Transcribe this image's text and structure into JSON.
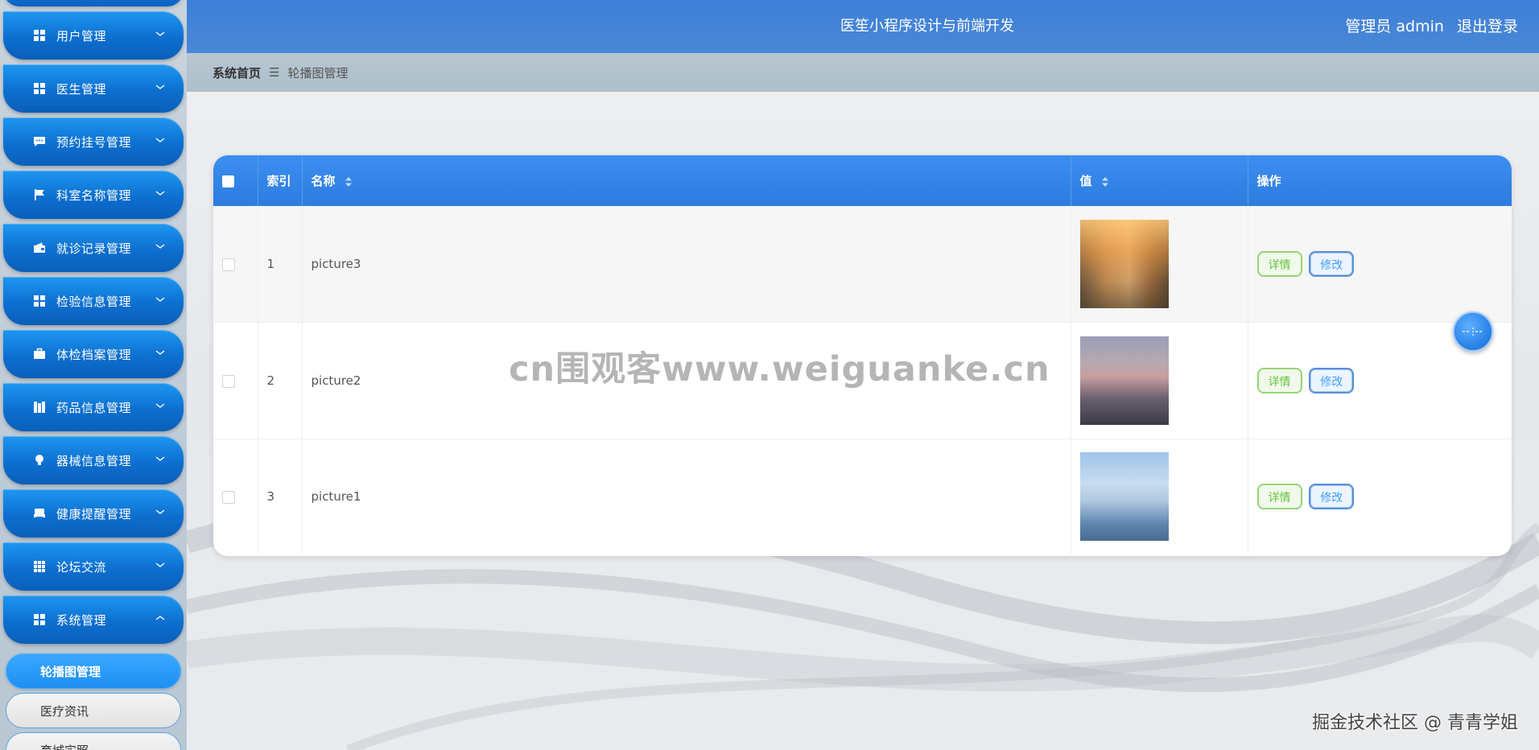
{
  "app": {
    "title": "医笙小程序设计与前端开发",
    "user_label": "管理员 admin",
    "logout_label": "退出登录"
  },
  "sidebar": {
    "items": [
      {
        "label": "用户管理",
        "icon": "grid-icon",
        "expanded": false
      },
      {
        "label": "医生管理",
        "icon": "grid-icon",
        "expanded": false
      },
      {
        "label": "预约挂号管理",
        "icon": "chat-icon",
        "expanded": false
      },
      {
        "label": "科室名称管理",
        "icon": "flag-icon",
        "expanded": false
      },
      {
        "label": "就诊记录管理",
        "icon": "wallet-icon",
        "expanded": false
      },
      {
        "label": "检验信息管理",
        "icon": "grid-icon",
        "expanded": false
      },
      {
        "label": "体检档案管理",
        "icon": "briefcase-icon",
        "expanded": false
      },
      {
        "label": "药品信息管理",
        "icon": "book-icon",
        "expanded": false
      },
      {
        "label": "器械信息管理",
        "icon": "bulb-icon",
        "expanded": false
      },
      {
        "label": "健康提醒管理",
        "icon": "printer-icon",
        "expanded": false
      },
      {
        "label": "论坛交流",
        "icon": "apps-icon",
        "expanded": false
      },
      {
        "label": "系统管理",
        "icon": "grid-icon",
        "expanded": true
      }
    ],
    "sub_items": [
      {
        "label": "轮播图管理",
        "active": true
      },
      {
        "label": "医疗资讯",
        "active": false
      },
      {
        "label": "育城实照",
        "active": false
      }
    ]
  },
  "breadcrumb": {
    "home": "系统首页",
    "separator": "☰",
    "current": "轮播图管理"
  },
  "table": {
    "columns": {
      "index": "索引",
      "name": "名称",
      "value": "值",
      "actions": "操作"
    },
    "rows": [
      {
        "index": "1",
        "name": "picture3",
        "thumb": "city-sunset-image"
      },
      {
        "index": "2",
        "name": "picture2",
        "thumb": "city-dusk-image"
      },
      {
        "index": "3",
        "name": "picture1",
        "thumb": "city-skyline-image"
      }
    ],
    "detail_label": "详情",
    "edit_label": "修改"
  },
  "watermarks": {
    "center": "cn围观客www.weiguanke.cn",
    "bottom_right": "掘金技术社区 @ 青青学姐"
  },
  "colors": {
    "header": "#3d7fd8",
    "menu_blue": "#0d6fd0",
    "table_header": "#3c8ef0",
    "detail_green": "#67c23a",
    "edit_blue": "#409eff"
  }
}
